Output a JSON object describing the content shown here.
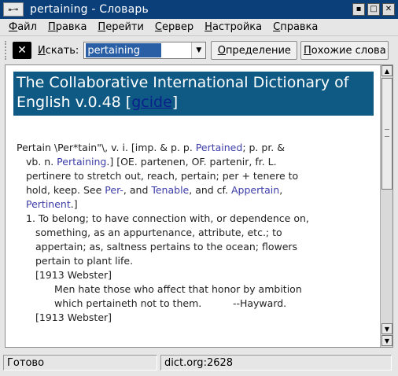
{
  "window": {
    "title": "pertaining - Словарь",
    "app_icon": "dictionary-app-icon",
    "buttons": [
      "minimize-icon",
      "maximize-icon",
      "close-icon"
    ]
  },
  "menubar": {
    "items": [
      {
        "first": "Ф",
        "rest": "айл"
      },
      {
        "first": "П",
        "rest": "равка"
      },
      {
        "first": "П",
        "rest": "ерейти"
      },
      {
        "first": "С",
        "rest": "ервер"
      },
      {
        "first": "Н",
        "rest": "астройка"
      },
      {
        "first": "С",
        "rest": "правка"
      }
    ]
  },
  "toolbar": {
    "search_label_first": "И",
    "search_label_rest": "скать:",
    "search_value": "pertaining",
    "define_button_first": "О",
    "define_button_rest": "пределение",
    "similar_button_first": "П",
    "similar_button_rest": "охожие слова"
  },
  "content": {
    "banner_title": "The Collaborative International Dictionary of English v.0.48 [",
    "banner_link": "gcide",
    "banner_close": "]",
    "entry": {
      "line1_a": "Pertain \\Per*tain\"\\, v. i. [imp. & p. p. ",
      "line1_link": "Pertained",
      "line1_b": "; p. pr. &",
      "line2_a": "vb. n. ",
      "line2_link": "Pertaining",
      "line2_b": ".] [OE. partenen, OF. partenir, fr. L.",
      "line3": "pertinere to stretch out, reach, pertain; per + tenere to",
      "line4_a": "hold, keep. See ",
      "line4_link1": "Per-",
      "line4_b": ", and ",
      "line4_link2": "Tenable",
      "line4_c": ", and cf. ",
      "line4_link3": "Appertain",
      "line4_d": ",",
      "line5_link": "Pertinent",
      "line5_b": ".]",
      "def1_l1": "1. To belong; to have connection with, or dependence on,",
      "def1_l2": "something, as an appurtenance, attribute, etc.; to",
      "def1_l3": "appertain; as, saltness pertains to the ocean; flowers",
      "def1_l4": "pertain to plant life.",
      "source1": "[1913 Webster]",
      "quote_l1": "Men hate those who affect that honor by ambition",
      "quote_l2": "which pertaineth not to them.          --Hayward.",
      "source2": "[1913 Webster]"
    }
  },
  "statusbar": {
    "status": "Готово",
    "server": "dict.org:2628"
  }
}
